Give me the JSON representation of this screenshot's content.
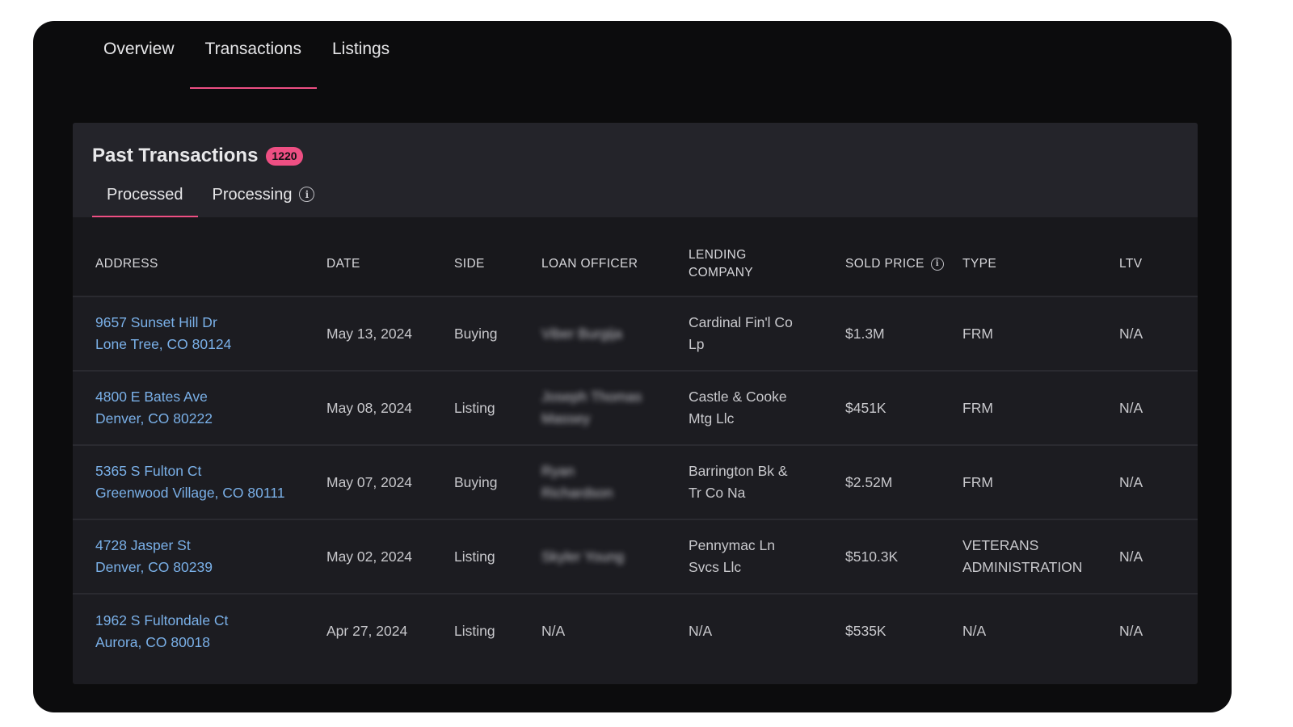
{
  "top_tabs": [
    {
      "label": "Overview",
      "active": false
    },
    {
      "label": "Transactions",
      "active": true
    },
    {
      "label": "Listings",
      "active": false
    }
  ],
  "section": {
    "title": "Past Transactions",
    "count": "1220",
    "sub_tabs": [
      {
        "label": "Processed",
        "active": true
      },
      {
        "label": "Processing",
        "active": false,
        "icon": "info-icon"
      }
    ]
  },
  "table": {
    "columns": {
      "address": "ADDRESS",
      "date": "DATE",
      "side": "SIDE",
      "loan_officer": "LOAN OFFICER",
      "lending_company_line1": "LENDING",
      "lending_company_line2": "COMPANY",
      "sold_price": "SOLD PRICE",
      "type": "TYPE",
      "ltv": "LTV"
    },
    "rows": [
      {
        "address_line1": "9657 Sunset Hill Dr",
        "address_line2": "Lone Tree, CO 80124",
        "date": "May 13, 2024",
        "side": "Buying",
        "loan_officer_line1": "Viber Burgija",
        "loan_officer_line2": "",
        "loan_officer_blurred": true,
        "lending_company_line1": "Cardinal Fin'l Co",
        "lending_company_line2": "Lp",
        "sold_price": "$1.3M",
        "type_line1": "FRM",
        "type_line2": "",
        "ltv": "N/A"
      },
      {
        "address_line1": "4800 E Bates Ave",
        "address_line2": "Denver, CO 80222",
        "date": "May 08, 2024",
        "side": "Listing",
        "loan_officer_line1": "Joseph Thomas",
        "loan_officer_line2": "Massey",
        "loan_officer_blurred": true,
        "lending_company_line1": "Castle & Cooke",
        "lending_company_line2": "Mtg Llc",
        "sold_price": "$451K",
        "type_line1": "FRM",
        "type_line2": "",
        "ltv": "N/A"
      },
      {
        "address_line1": "5365 S Fulton Ct",
        "address_line2": "Greenwood Village, CO 80111",
        "date": "May 07, 2024",
        "side": "Buying",
        "loan_officer_line1": "Ryan",
        "loan_officer_line2": "Richardson",
        "loan_officer_blurred": true,
        "lending_company_line1": "Barrington Bk &",
        "lending_company_line2": "Tr Co Na",
        "sold_price": "$2.52M",
        "type_line1": "FRM",
        "type_line2": "",
        "ltv": "N/A"
      },
      {
        "address_line1": "4728 Jasper St",
        "address_line2": "Denver, CO 80239",
        "date": "May 02, 2024",
        "side": "Listing",
        "loan_officer_line1": "Skyler Young",
        "loan_officer_line2": "",
        "loan_officer_blurred": true,
        "lending_company_line1": "Pennymac Ln",
        "lending_company_line2": "Svcs Llc",
        "sold_price": "$510.3K",
        "type_line1": "VETERANS",
        "type_line2": "ADMINISTRATION",
        "ltv": "N/A"
      },
      {
        "address_line1": "1962 S Fultondale Ct",
        "address_line2": "Aurora, CO 80018",
        "date": "Apr 27, 2024",
        "side": "Listing",
        "loan_officer_line1": "N/A",
        "loan_officer_line2": "",
        "loan_officer_blurred": false,
        "lending_company_line1": "N/A",
        "lending_company_line2": "",
        "sold_price": "$535K",
        "type_line1": "N/A",
        "type_line2": "",
        "ltv": "N/A"
      }
    ]
  },
  "colors": {
    "accent": "#ee4f83",
    "link": "#7ab0e8",
    "frame_bg": "#0c0c0d",
    "card_bg": "#1c1c21"
  }
}
